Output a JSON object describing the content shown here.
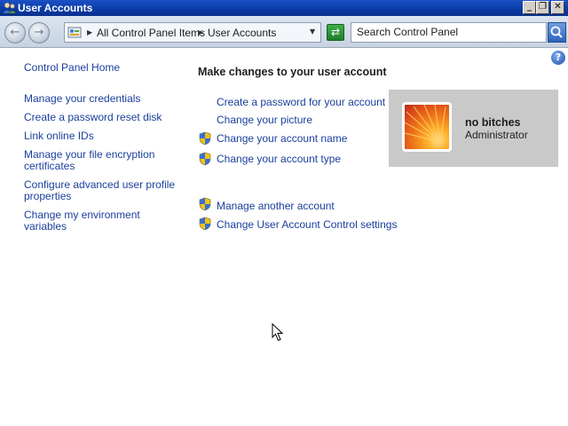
{
  "window": {
    "title": "User Accounts"
  },
  "address_bar": {
    "crumbs": [
      "All Control Panel Items",
      "User Accounts"
    ]
  },
  "search": {
    "placeholder": "Search Control Panel"
  },
  "left_nav": {
    "home": "Control Panel Home",
    "items": [
      "Manage your credentials",
      "Create a password reset disk",
      "Link online IDs",
      "Manage your file encryption certificates",
      "Configure advanced user profile properties",
      "Change my environment variables"
    ]
  },
  "main": {
    "heading": "Make changes to your user account",
    "tasks": [
      "Create a password for your account",
      "Change your picture",
      "Change your account name",
      "Change your account type"
    ],
    "other_tasks": [
      "Manage another account",
      "Change User Account Control settings"
    ]
  },
  "account": {
    "name": "no bitches",
    "role": "Administrator"
  },
  "colors": {
    "link": "#1a3f9c",
    "titlebar": "#0b3ca8",
    "panel": "#c9c9c9"
  },
  "icons": {
    "app": "user-accounts-icon",
    "back": "back-arrow-icon",
    "forward": "forward-arrow-icon",
    "refresh": "refresh-icon",
    "search": "search-icon",
    "help": "help-icon",
    "shield": "uac-shield-icon"
  }
}
